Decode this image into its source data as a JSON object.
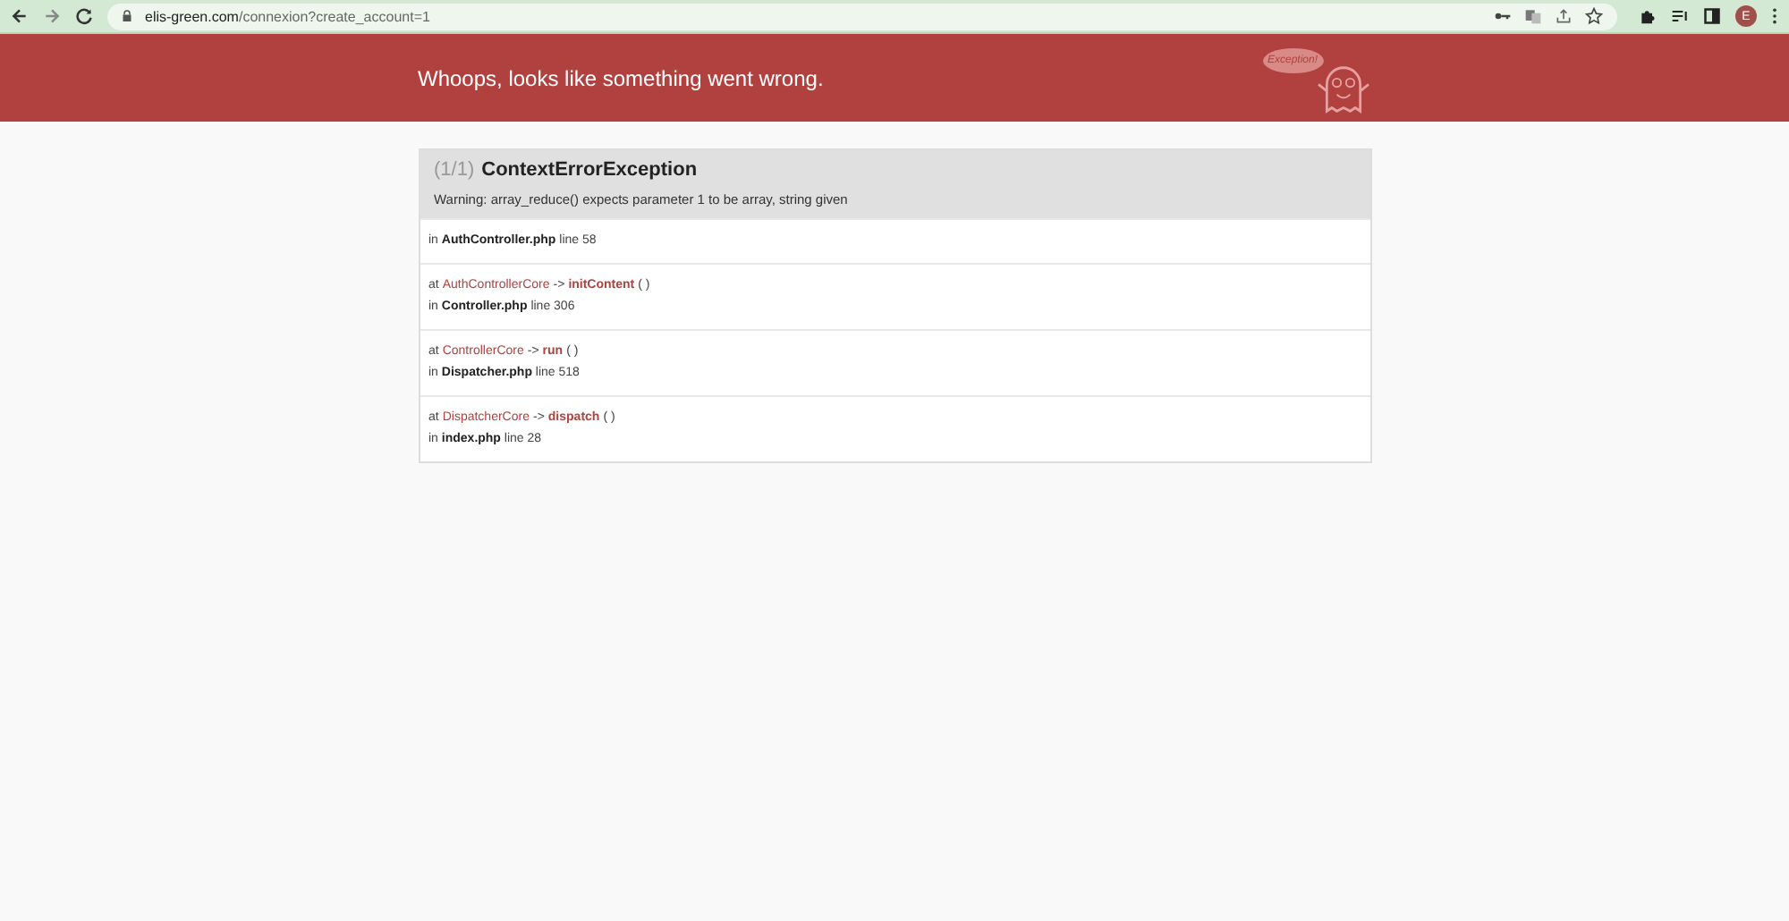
{
  "browser": {
    "url_host": "elis-green.com",
    "url_path": "/connexion?create_account=1",
    "avatar": "E"
  },
  "header": {
    "title": "Whoops, looks like something went wrong.",
    "logo_text": "Exception!"
  },
  "exception": {
    "counter": "(1/1)",
    "name": "ContextErrorException",
    "message": "Warning: array_reduce() expects parameter 1 to be array, string given"
  },
  "trace": [
    {
      "location": "in **AuthController.php** line 58"
    },
    {
      "call": {
        "prefix": "at",
        "class": "AuthControllerCore",
        "arrow": "->",
        "method": "initContent",
        "args": "( )"
      },
      "location": "in **Controller.php** line 306"
    },
    {
      "call": {
        "prefix": "at",
        "class": "ControllerCore",
        "arrow": "->",
        "method": "run",
        "args": "( )"
      },
      "location": "in **Dispatcher.php** line 518"
    },
    {
      "call": {
        "prefix": "at",
        "class": "DispatcherCore",
        "arrow": "->",
        "method": "dispatch",
        "args": "( )"
      },
      "location": "in **index.php** line 28"
    }
  ]
}
